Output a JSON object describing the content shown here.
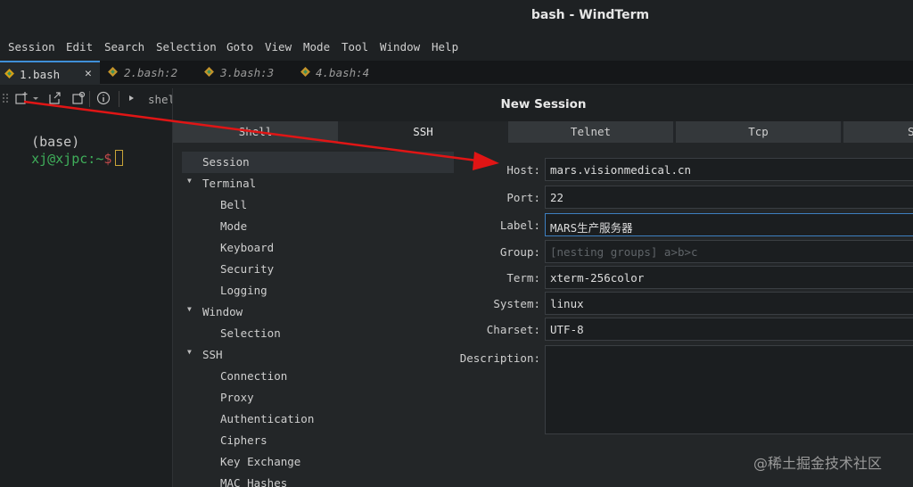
{
  "window": {
    "title": "bash - WindTerm"
  },
  "menu": [
    "Session",
    "Edit",
    "Search",
    "Selection",
    "Goto",
    "View",
    "Mode",
    "Tool",
    "Window",
    "Help"
  ],
  "tabs": [
    {
      "label": "1.bash",
      "active": true
    },
    {
      "label": "2.bash:2",
      "active": false
    },
    {
      "label": "3.bash:3",
      "active": false
    },
    {
      "label": "4.bash:4",
      "active": false
    }
  ],
  "toolbar": {
    "shell_label": "shel"
  },
  "terminal": {
    "base": "(base)",
    "user": "xj@xjpc",
    "sep": ":",
    "path": "~",
    "dollar": "$"
  },
  "dialog": {
    "title": "New Session",
    "tabs": [
      "Shell",
      "SSH",
      "Telnet",
      "Tcp",
      "S"
    ],
    "tree": [
      "Session",
      "Terminal",
      "Bell",
      "Mode",
      "Keyboard",
      "Security",
      "Logging",
      "Window",
      "Selection",
      "SSH",
      "Connection",
      "Proxy",
      "Authentication",
      "Ciphers",
      "Key Exchange",
      "MAC Hashes"
    ],
    "fields": {
      "host": {
        "label": "Host:",
        "value": "mars.visionmedical.cn"
      },
      "port": {
        "label": "Port:",
        "value": "22"
      },
      "label": {
        "label": "Label:",
        "value": "MARS生产服务器"
      },
      "group": {
        "label": "Group:",
        "placeholder": "[nesting groups] a>b>c"
      },
      "term": {
        "label": "Term:",
        "value": "xterm-256color"
      },
      "system": {
        "label": "System:",
        "value": "linux"
      },
      "charset": {
        "label": "Charset:",
        "value": "UTF-8"
      },
      "description": {
        "label": "Description:",
        "value": ""
      }
    }
  },
  "watermark": "@稀土掘金技术社区",
  "colors": {
    "accent": "#3f8fd8",
    "arrow": "#e01515",
    "prompt_user": "#3fae5a"
  }
}
